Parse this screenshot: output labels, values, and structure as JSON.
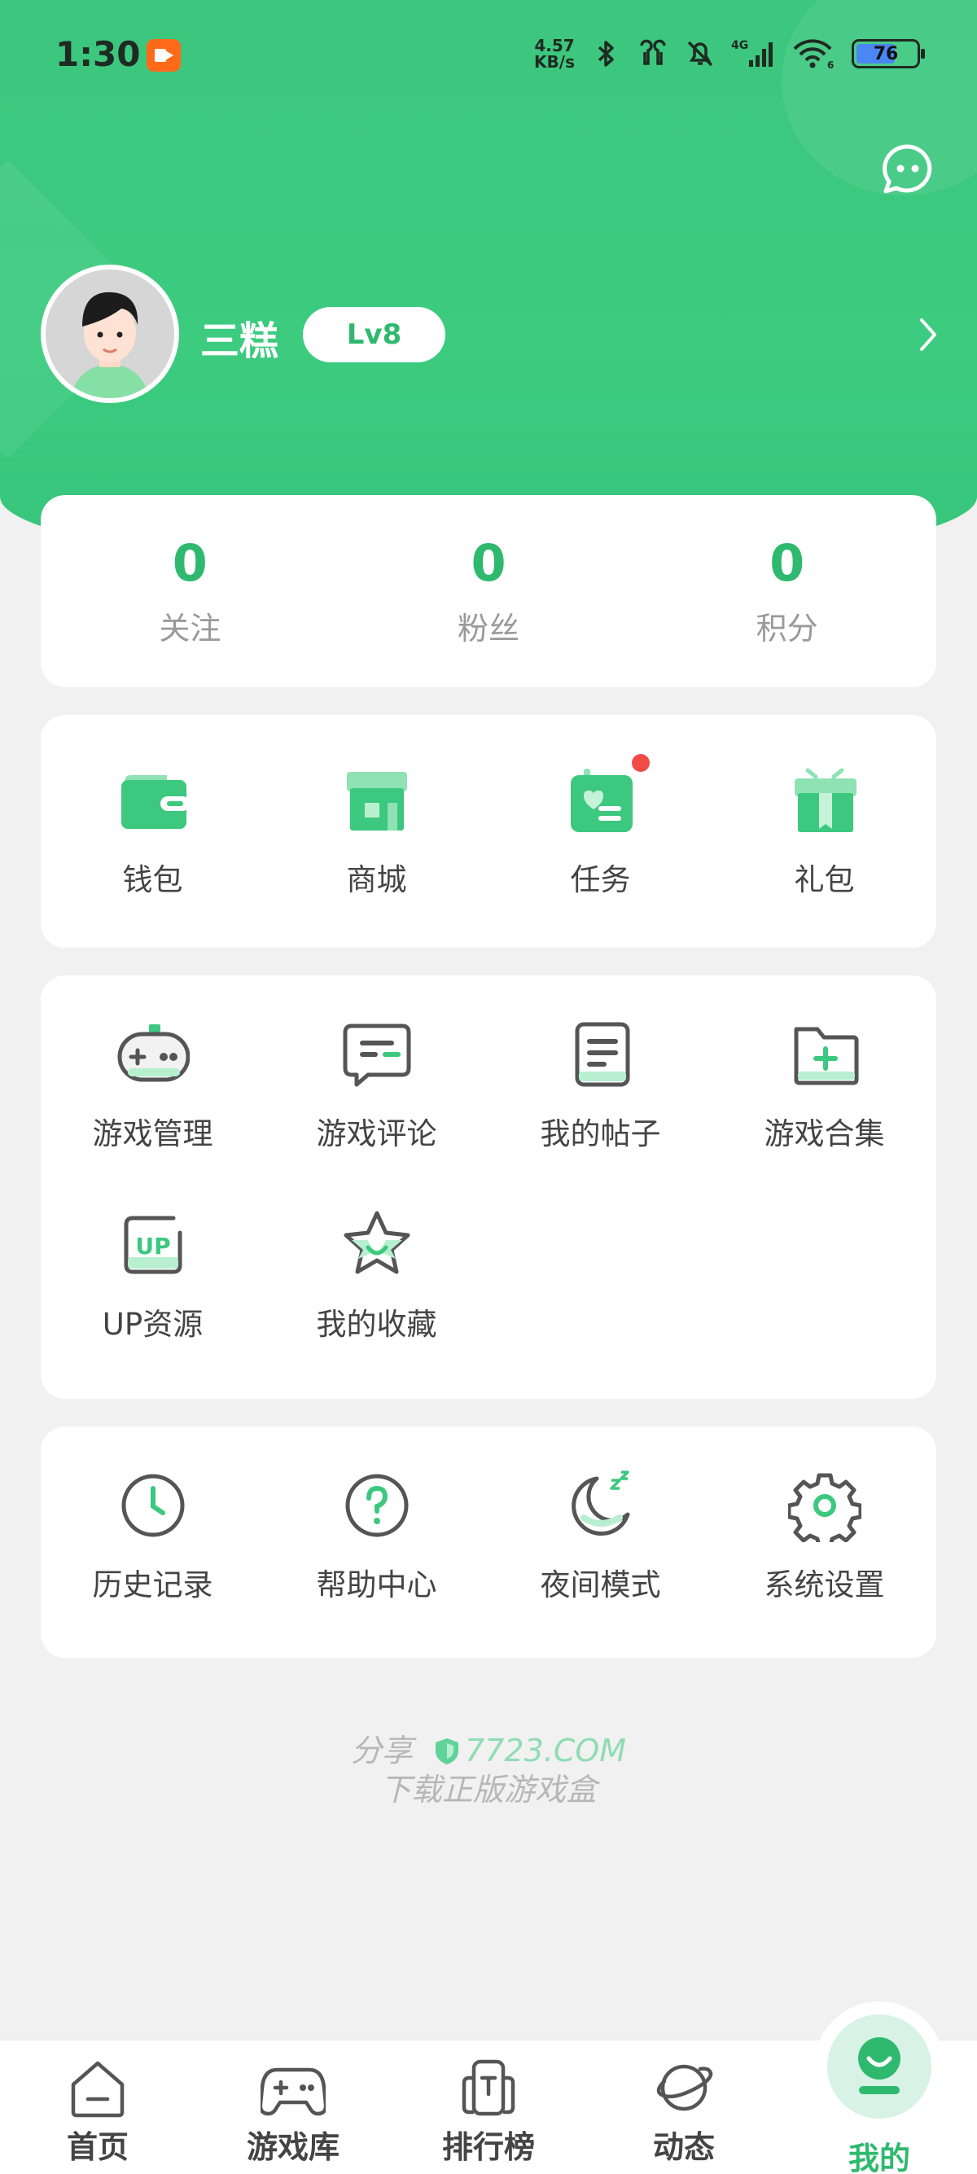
{
  "status_bar": {
    "time": "1:30",
    "net_speed_value": "4.57",
    "net_speed_unit": "KB/s",
    "network": "4G",
    "wifi_channel": "6",
    "battery": "76"
  },
  "profile": {
    "username": "三糕",
    "level": "Lv8"
  },
  "stats": [
    {
      "value": "0",
      "label": "关注"
    },
    {
      "value": "0",
      "label": "粉丝"
    },
    {
      "value": "0",
      "label": "积分"
    }
  ],
  "quick": [
    {
      "label": "钱包",
      "icon": "wallet-icon"
    },
    {
      "label": "商城",
      "icon": "store-icon"
    },
    {
      "label": "任务",
      "icon": "task-icon",
      "has_badge": true
    },
    {
      "label": "礼包",
      "icon": "gift-icon"
    }
  ],
  "services": [
    {
      "label": "游戏管理",
      "icon": "gamepad-icon"
    },
    {
      "label": "游戏评论",
      "icon": "comment-icon"
    },
    {
      "label": "我的帖子",
      "icon": "post-icon"
    },
    {
      "label": "游戏合集",
      "icon": "folder-plus-icon"
    },
    {
      "label": "UP资源",
      "icon": "up-resource-icon"
    },
    {
      "label": "我的收藏",
      "icon": "star-icon"
    }
  ],
  "settings": [
    {
      "label": "历史记录",
      "icon": "clock-icon"
    },
    {
      "label": "帮助中心",
      "icon": "help-icon"
    },
    {
      "label": "夜间模式",
      "icon": "moon-icon"
    },
    {
      "label": "系统设置",
      "icon": "gear-icon"
    }
  ],
  "share": {
    "prefix": "分享",
    "brand": "7723.COM",
    "subtitle": "下载正版游戏盒"
  },
  "tabs": [
    {
      "label": "首页",
      "icon": "home-icon"
    },
    {
      "label": "游戏库",
      "icon": "gamepad-icon"
    },
    {
      "label": "排行榜",
      "icon": "ranking-icon"
    },
    {
      "label": "动态",
      "icon": "planet-icon"
    },
    {
      "label": "我的",
      "icon": "profile-icon",
      "active": true
    }
  ],
  "colors": {
    "brand_green": "#3cc87e",
    "accent_text": "#2fb96f",
    "badge_red": "#f04b45",
    "page_bg": "#f1f1f1"
  }
}
